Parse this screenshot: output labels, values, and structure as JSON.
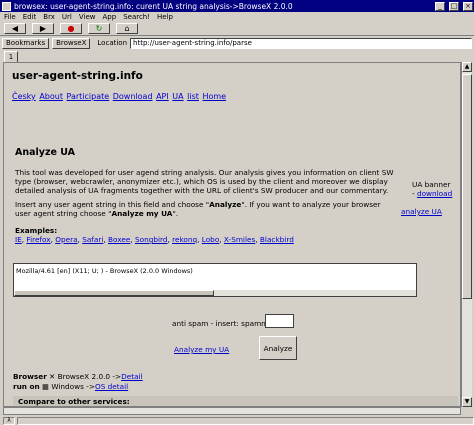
{
  "window": {
    "title": "browsex: user-agent-string.info: curent UA string analysis->BrowseX 2.0.0",
    "minimize": "_",
    "maximize": "□",
    "close": "×"
  },
  "menu": [
    "File",
    "Edit",
    "Brx",
    "Url",
    "View",
    "App",
    "Search!",
    "Help"
  ],
  "toolbar": {
    "back": "◀",
    "forward": "▶",
    "stop": "●",
    "reload": "↻",
    "home": "⌂"
  },
  "locationbar": {
    "bookmarks_label": "Bookmarks",
    "brand_label": "BrowseX",
    "location_label": "Location",
    "url": "http://user-agent-string.info/parse"
  },
  "tab": {
    "label": "1"
  },
  "page": {
    "site_title": "user-agent-string.info",
    "nav": [
      "Česky",
      "About",
      "Participate",
      "Download",
      "API",
      "UA",
      "list",
      "Home"
    ],
    "heading": "Analyze UA",
    "description": "This tool was developed for user agend string analysis.  Our analysis gives you information on client SW type (browser, webcrawler, anonymizer etc.), which OS is used by the client and moreover we display detailed analysis of UA fragments together with the URL of client's SW producer and our commentary.",
    "instruction_1": "Insert any user agent string in this field and choose \"",
    "instruction_analyze": "Analyze",
    "instruction_2": "\".  If you want to analyze your browser user agent string choose \"",
    "instruction_analyze_my": "Analyze my UA",
    "instruction_3": "\".",
    "banner_alt": "UA banner",
    "banner_download": "download",
    "banner_sep": "- ",
    "analyze_ua_link": "analyze UA",
    "examples_title": "Examples:",
    "examples": [
      "IE",
      "Firefox",
      "Opera",
      "Safari",
      "Boxee",
      "Songbird",
      "rekonq",
      "Lobo",
      "X-Smiles",
      "Blackbird"
    ],
    "ua_value": "Mozilla/4.61 [en] (X11; U; ) - BrowseX (2.0.0 Windows)",
    "spam_label": "anti spam - insert:  spamno",
    "analyze_my_link": "Analyze my UA",
    "analyze_button": "Analyze",
    "browser_label": "Browser",
    "browser_name": "BrowseX 2.0.0 ->",
    "browser_detail": "Detail",
    "runon_label": "run on",
    "os_name": "Windows ->",
    "os_detail": "OS detail",
    "compare": "Compare to other services:"
  },
  "status": {
    "indicator": "λ"
  }
}
